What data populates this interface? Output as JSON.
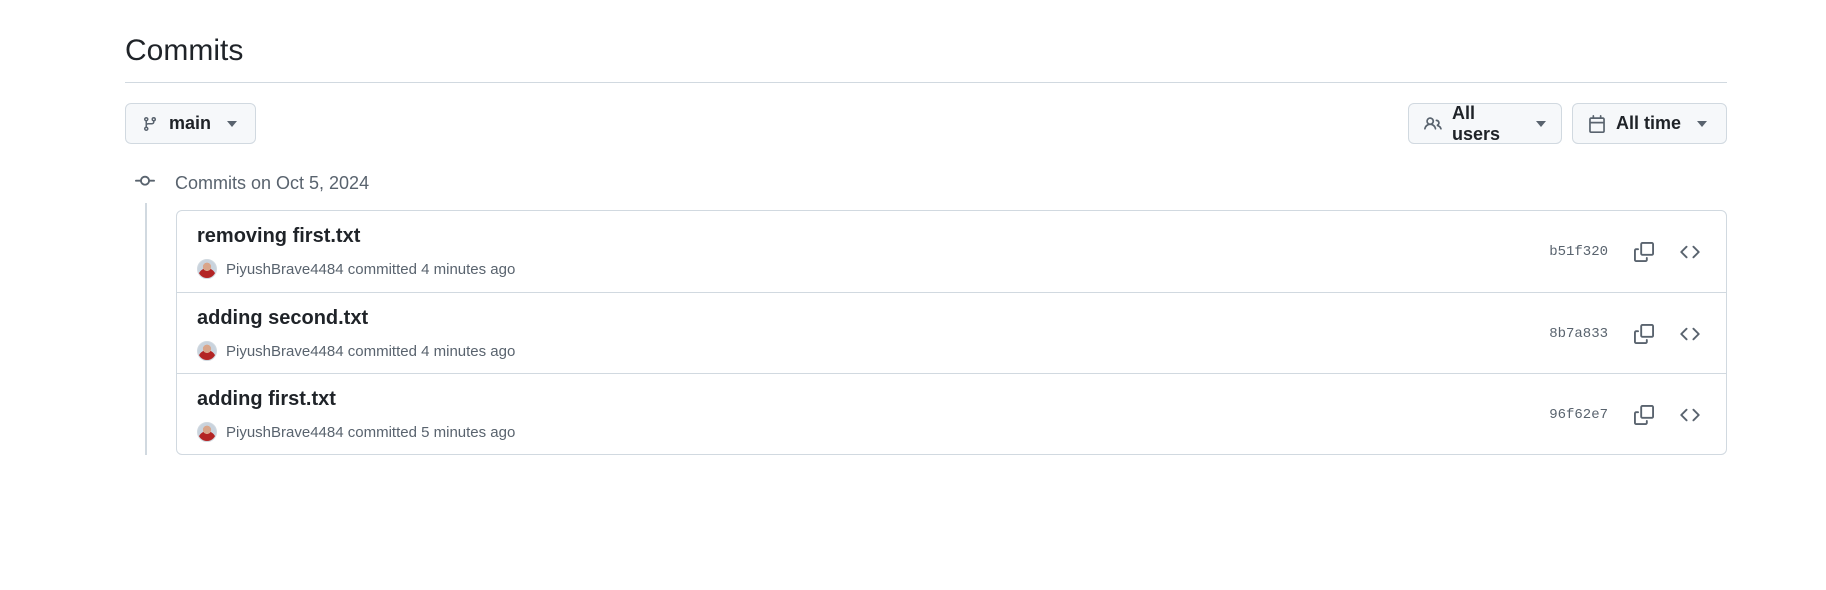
{
  "page_title": "Commits",
  "filters": {
    "branch": "main",
    "users": "All users",
    "time": "All time"
  },
  "day_group": {
    "label": "Commits on Oct 5, 2024"
  },
  "commits": [
    {
      "message": "removing first.txt",
      "author": "PiyushBrave4484",
      "action": "committed",
      "time": "4 minutes ago",
      "sha": "b51f320"
    },
    {
      "message": "adding second.txt",
      "author": "PiyushBrave4484",
      "action": "committed",
      "time": "4 minutes ago",
      "sha": "8b7a833"
    },
    {
      "message": "adding first.txt",
      "author": "PiyushBrave4484",
      "action": "committed",
      "time": "5 minutes ago",
      "sha": "96f62e7"
    }
  ],
  "icons": {
    "branch": "git-branch-icon",
    "users": "people-icon",
    "time": "calendar-icon",
    "commit": "git-commit-icon",
    "copy": "copy-icon",
    "browse": "code-icon"
  }
}
